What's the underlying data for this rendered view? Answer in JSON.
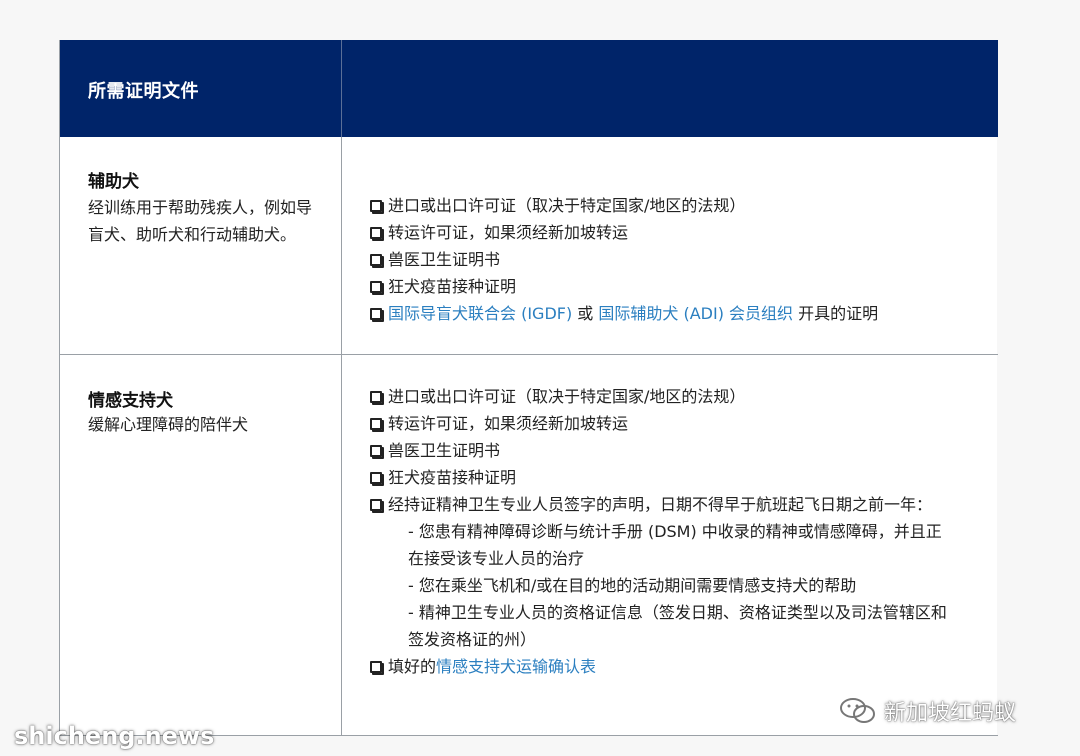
{
  "header": {
    "title": "所需证明文件"
  },
  "rows": [
    {
      "title": "辅助犬",
      "description": "经训练用于帮助残疾人，例如导盲犬、助听犬和行动辅助犬。",
      "requirements": [
        "进口或出口许可证（取决于特定国家/地区的法规）",
        "转运许可证，如果须经新加坡转运",
        "兽医卫生证明书",
        "狂犬疫苗接种证明"
      ],
      "last_requirement": {
        "link1": "国际导盲犬联合会 (IGDF)",
        "mid": " 或 ",
        "link2": "国际辅助犬 (ADI) 会员组织",
        "tail": " 开具的证明"
      }
    },
    {
      "title": "情感支持犬",
      "description": "缓解心理障碍的陪伴犬",
      "requirements": [
        "进口或出口许可证（取决于特定国家/地区的法规）",
        "转运许可证，如果须经新加坡转运",
        "兽医卫生证明书",
        "狂犬疫苗接种证明",
        "经持证精神卫生专业人员签字的声明，日期不得早于航班起飞日期之前一年："
      ],
      "sub_items": [
        "- 您患有精神障碍诊断与统计手册 (DSM) 中收录的精神或情感障碍，并且正在接受该专业人员的治疗",
        "- 您在乘坐飞机和/或在目的地的活动期间需要情感支持犬的帮助",
        "- 精神卫生专业人员的资格证信息（签发日期、资格证类型以及司法管辖区和签发资格证的州）"
      ],
      "last_requirement": {
        "prefix": "填好的",
        "link": "情感支持犬运输确认表"
      }
    }
  ],
  "watermarks": {
    "right": "新加坡红蚂蚁",
    "left": "shicheng.news",
    "right_icon": "wechat-icon"
  },
  "colors": {
    "header_bg": "#002469",
    "link": "#2b7fc0"
  }
}
